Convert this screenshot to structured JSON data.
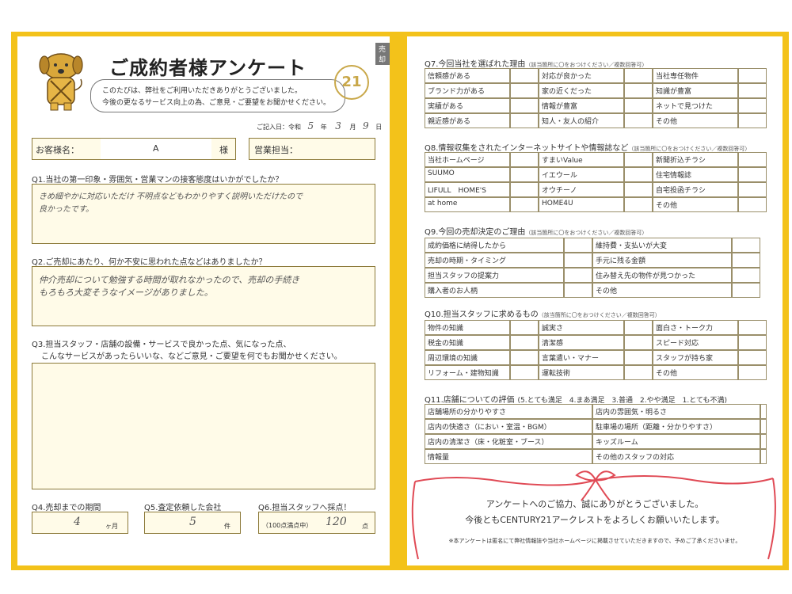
{
  "left": {
    "tag": "売却",
    "title": "ご成約者様アンケート",
    "intro_line1": "このたびは、弊社をご利用いただきありがとうございました。",
    "intro_line2": "今後の更なるサービス向上の為、ご意見・ご要望をお聞かせください。",
    "date_label": "ご記入日：令和",
    "date_year": "5",
    "date_year_unit": "年",
    "date_month": "3",
    "date_month_unit": "月",
    "date_day": "9",
    "date_day_unit": "日",
    "customer_label": "お客様名：",
    "customer_value": "A",
    "customer_suffix": "様",
    "sales_label": "営業担当：",
    "q1": "Q1.当社の第一印象・雰囲気・営業マンの接客態度はいかがでしたか？",
    "q1_answer_line1": "きめ細やかに対応いただけ 不明点などもわかりやすく説明いただけたので",
    "q1_answer_line2": "良かったです。",
    "q2": "Q2.ご売却にあたり、何か不安に思われた点などはありましたか？",
    "q2_answer_line1": "仲介売却について勉強する時間が取れなかったので、売却の手続き",
    "q2_answer_line2": "もろもろ大変そうなイメージがありました。",
    "q3_line1": "Q3.担当スタッフ・店舗の設備・サービスで良かった点、気になった点、",
    "q3_line2": "こんなサービスがあったらいいな、などご意見・ご要望を何でもお聞かせください。",
    "q4": "Q4.売却までの期間",
    "q4_value": "4",
    "q4_unit": "ヶ月",
    "q5": "Q5.査定依頼した会社",
    "q5_value": "5",
    "q5_unit": "件",
    "q6": "Q6.担当スタッフへ採点！",
    "q6_note": "（100点満点中）",
    "q6_value": "120",
    "q6_unit": "点",
    "logo_text": "21"
  },
  "right": {
    "q7_title": "Q7.今回当社を選ばれた理由",
    "q7_note": "（該当箇所に〇をおつけください／複数回答可）",
    "q7_rows": [
      [
        "信頼感がある",
        "対応が良かった",
        "当社専任物件"
      ],
      [
        "ブランド力がある",
        "家の近くだった",
        "知識が豊富"
      ],
      [
        "実績がある",
        "情報が豊富",
        "ネットで見つけた"
      ],
      [
        "親近感がある",
        "知人・友人の紹介",
        "その他"
      ]
    ],
    "q8_title": "Q8.情報収集をされたインターネットサイトや情報誌など",
    "q8_note": "（該当箇所に〇をおつけください／複数回答可）",
    "q8_rows": [
      [
        "当社ホームページ",
        "すまいValue",
        "新聞折込チラシ"
      ],
      [
        "SUUMO",
        "イエウール",
        "住宅情報誌"
      ],
      [
        "LIFULL　HOME'S",
        "オウチーノ",
        "自宅投函チラシ"
      ],
      [
        "at home",
        "HOME4U",
        "その他"
      ]
    ],
    "q9_title": "Q9.今回の売却決定のご理由",
    "q9_note": "（該当箇所に〇をおつけください／複数回答可）",
    "q9_rows": [
      [
        "成約価格に納得したから",
        "維持費・支払いが大変"
      ],
      [
        "売却の時期・タイミング",
        "手元に残る金額"
      ],
      [
        "担当スタッフの提案力",
        "住み替え先の物件が見つかった"
      ],
      [
        "購入者のお人柄",
        "その他"
      ]
    ],
    "q10_title": "Q10.担当スタッフに求めるもの",
    "q10_note": "（該当箇所に〇をおつけください／複数回答可）",
    "q10_rows": [
      [
        "物件の知識",
        "誠実さ",
        "面白さ・トーク力"
      ],
      [
        "税金の知識",
        "清潔感",
        "スピード対応"
      ],
      [
        "周辺環境の知識",
        "言葉遣い・マナー",
        "スタッフが持ち家"
      ],
      [
        "リフォーム・建物知識",
        "運転技術",
        "その他"
      ]
    ],
    "q11_title": "Q11.店舗についての評価",
    "q11_scale": "(5.とても満足　4.まあ満足　3.普通　2.やや満足　1.とても不満)",
    "q11_rows": [
      [
        "店舗場所の分かりやすさ",
        "店内の雰囲気・明るさ"
      ],
      [
        "店内の快適さ（におい・室温・BGM）",
        "駐車場の場所（距離・分かりやすさ）"
      ],
      [
        "店内の清潔さ（床・化粧室・ブース）",
        "キッズルーム"
      ],
      [
        "情報量",
        "その他のスタッフの対応"
      ]
    ],
    "thanks_line1": "アンケートへのご協力、誠にありがとうございました。",
    "thanks_line2": "今後ともCENTURY21アークレストをよろしくお願いいたします。",
    "footnote": "※本アンケートは匿名にて弊社情報誌や当社ホームページに掲載させていただきますので、予めご了承くださいませ。",
    "ribbon_color": "#e04a55"
  },
  "colors": {
    "frame": "#f3c21a",
    "box_fill": "#fffbe8"
  }
}
